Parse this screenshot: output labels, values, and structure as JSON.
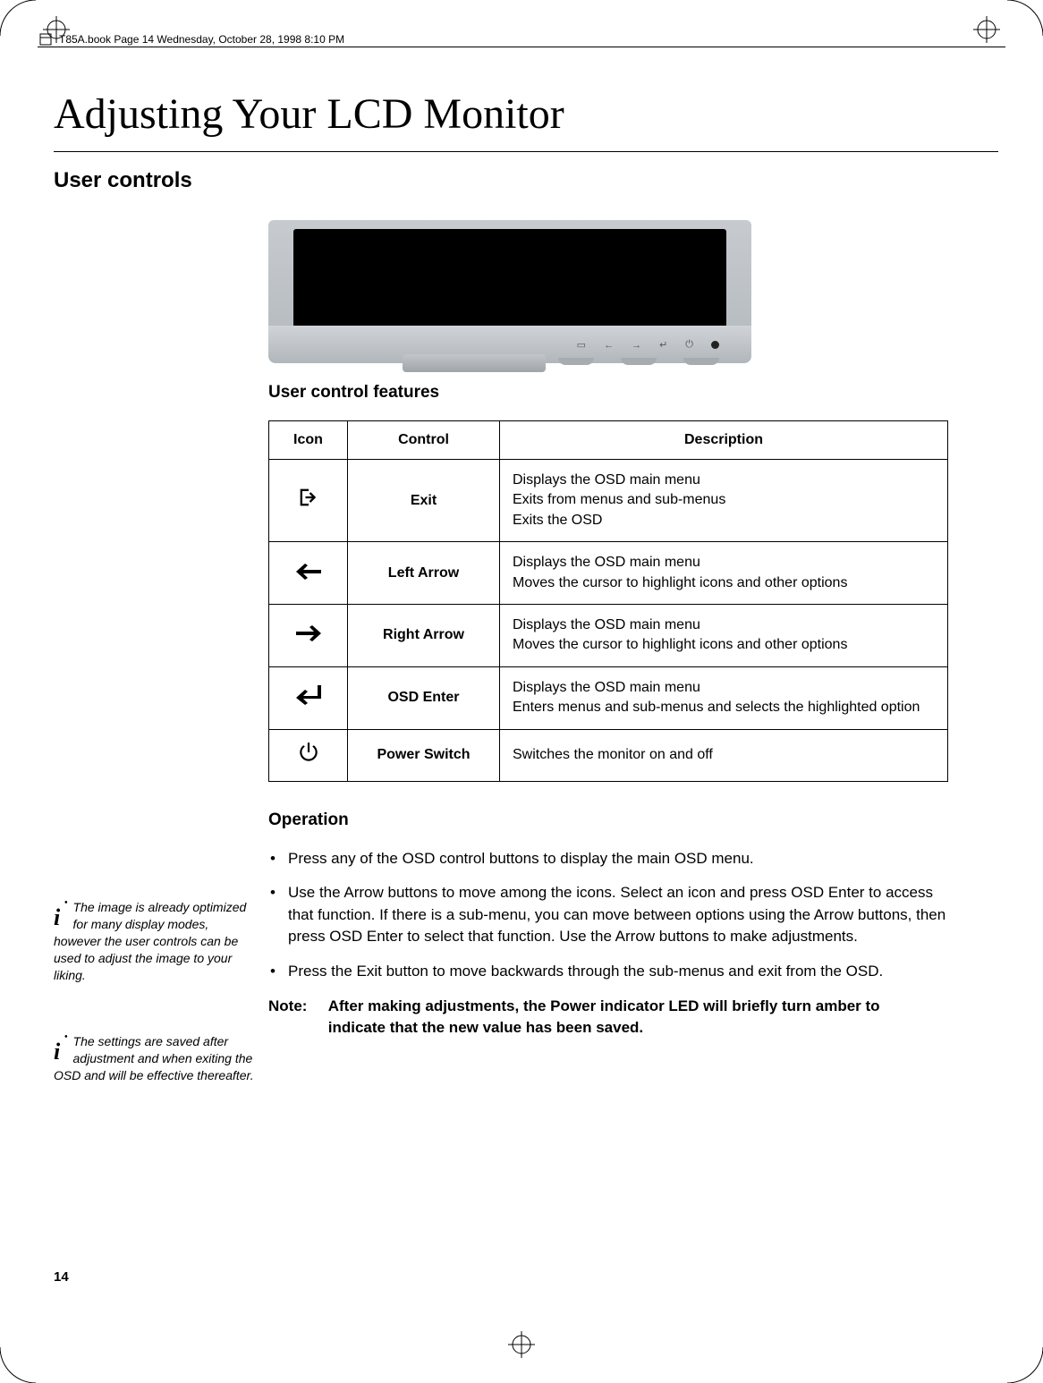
{
  "header": "T85A.book  Page 14  Wednesday, October 28, 1998  8:10 PM",
  "title": "Adjusting Your LCD Monitor",
  "section": "User controls",
  "subheading1": "User control features",
  "table": {
    "cols": {
      "icon": "Icon",
      "control": "Control",
      "description": "Description"
    },
    "rows": [
      {
        "icon": "exit",
        "control": "Exit",
        "desc": "Displays the OSD main menu\nExits from menus and sub-menus\nExits the OSD"
      },
      {
        "icon": "left",
        "control": "Left Arrow",
        "desc": "Displays the OSD main menu\nMoves the cursor to highlight icons and other options"
      },
      {
        "icon": "right",
        "control": "Right Arrow",
        "desc": "Displays the OSD main menu\nMoves the cursor to highlight icons and other options"
      },
      {
        "icon": "enter",
        "control": "OSD Enter",
        "desc": "Displays the OSD main menu\nEnters menus and sub-menus and selects the highlighted option"
      },
      {
        "icon": "power",
        "control": "Power Switch",
        "desc": "Switches the monitor on and off"
      }
    ]
  },
  "subheading2": "Operation",
  "operation": [
    "Press any of the OSD control buttons to display the main OSD menu.",
    "Use the Arrow buttons to move among the icons. Select an icon and press OSD Enter to access that function. If there is a sub-menu, you can move between options using the Arrow buttons, then press OSD Enter to select that function. Use the Arrow buttons to make adjustments.",
    "Press the Exit button to move backwards through the sub-menus and exit from the OSD."
  ],
  "note": {
    "label": "Note:",
    "body": "After making adjustments, the Power indicator LED will briefly turn amber to indicate that the new value has been saved."
  },
  "sidenotes": [
    "The image is already optimized for many display modes, however the user controls can be used to adjust the image to your liking.",
    "The settings are saved after adjustment and when exiting the OSD and will be effective thereafter."
  ],
  "pageNumber": "14",
  "icons": {
    "exit": "↪",
    "left": "←",
    "right": "→",
    "enter": "↵",
    "power": "⏻"
  }
}
